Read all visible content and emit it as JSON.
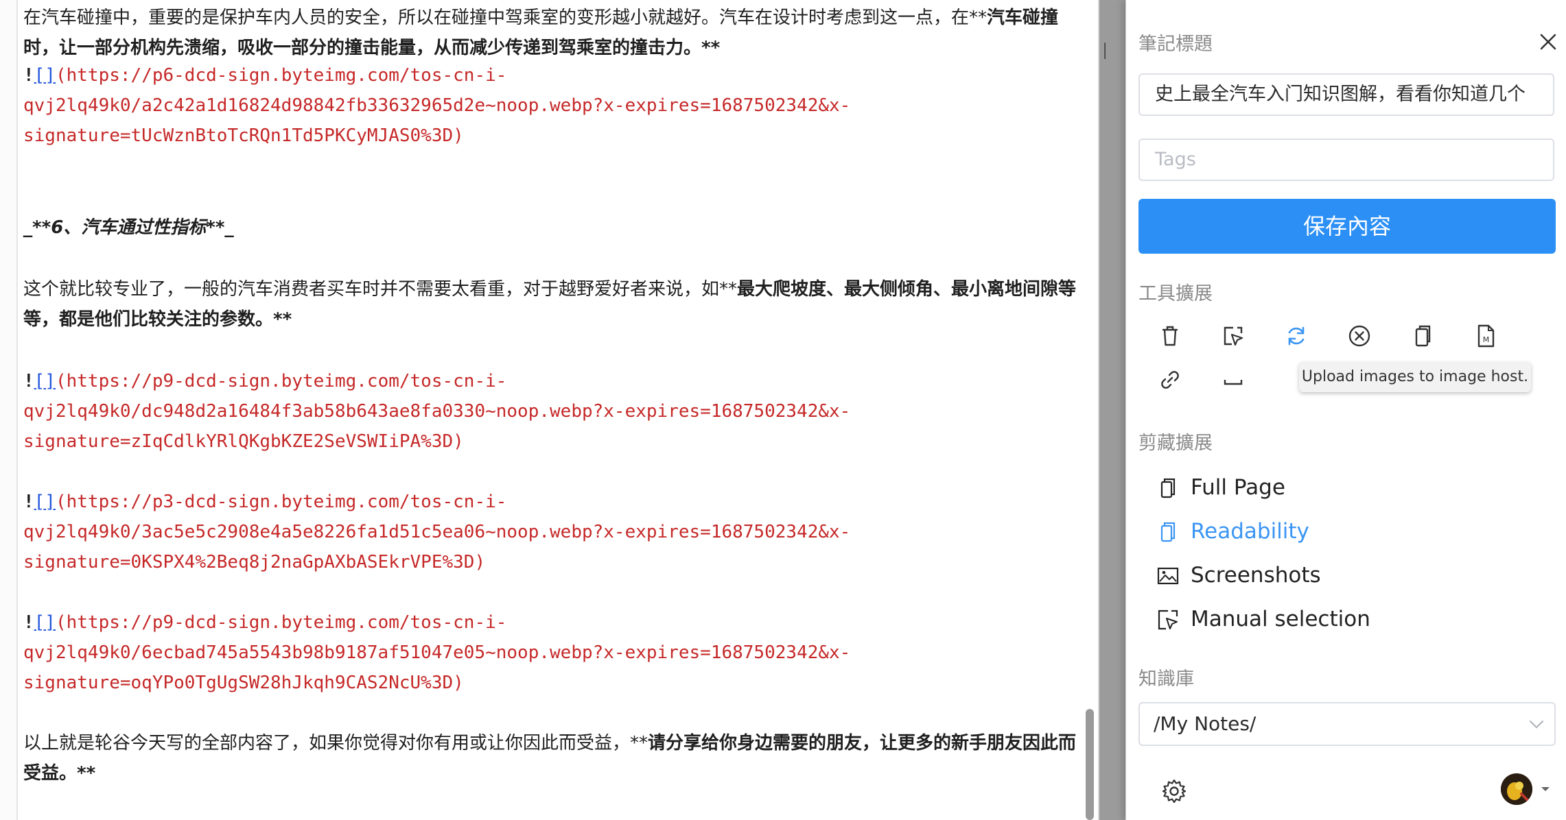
{
  "editor": {
    "para1": {
      "plain": "在汽车碰撞中，重要的是保护车内人员的安全，所以在碰撞中驾乘室的变形越小就越好。汽车在设计时考虑到这一点，在**",
      "bold": "汽车碰撞时，让一部分机构先溃缩，吸收一部分的撞击能量，从而减少传递到驾乘室的撞击力。**"
    },
    "link1": {
      "bang": "!",
      "brackets": "[]",
      "line1": "(https://p6-dcd-sign.byteimg.com/tos-cn-i-",
      "line2": "qvj2lq49k0/a2c42a1d16824d98842fb33632965d2e~noop.webp?x-expires=1687502342&x-",
      "line3": "signature=tUcWznBtoTcRQn1Td5PKCyMJAS0%3D)"
    },
    "heading": "_**6、汽车通过性指标**_",
    "para2": {
      "plain": "这个就比较专业了，一般的汽车消费者买车时并不需要太看重，对于越野爱好者来说，如**",
      "bold": "最大爬坡度、最大侧倾角、最小离地间隙等等，都是他们比较关注的参数。**"
    },
    "link2": {
      "bang": "!",
      "brackets": "[]",
      "line1": "(https://p9-dcd-sign.byteimg.com/tos-cn-i-",
      "line2": "qvj2lq49k0/dc948d2a16484f3ab58b643ae8fa0330~noop.webp?x-expires=1687502342&x-",
      "line3": "signature=zIqCdlkYRlQKgbKZE2SeVSWIiPA%3D)"
    },
    "link3": {
      "bang": "!",
      "brackets": "[]",
      "line1": "(https://p3-dcd-sign.byteimg.com/tos-cn-i-",
      "line2": "qvj2lq49k0/3ac5e5c2908e4a5e8226fa1d51c5ea06~noop.webp?x-expires=1687502342&x-",
      "line3": "signature=0KSPX4%2Beq8j2naGpAXbASEkrVPE%3D)"
    },
    "link4": {
      "bang": "!",
      "brackets": "[]",
      "line1": "(https://p9-dcd-sign.byteimg.com/tos-cn-i-",
      "line2": "qvj2lq49k0/6ecbad745a5543b98b9187af51047e05~noop.webp?x-expires=1687502342&x-",
      "line3": "signature=oqYPo0TgUgSW28hJkqh9CAS2NcU%3D)"
    },
    "para3": {
      "plain": "以上就是轮谷今天写的全部内容了，如果你觉得对你有用或让你因此而受益，**",
      "bold": "请分享给你身边需要的朋友，让更多的新手朋友因此而受益。**"
    }
  },
  "panel": {
    "note_title_label": "筆記標題",
    "note_title_value": "史上最全汽车入门知识图解，看看你知道几个",
    "tags_placeholder": "Tags",
    "save_button": "保存內容",
    "tools_label": "工具擴展",
    "tools": [
      {
        "icon": "trash-icon"
      },
      {
        "icon": "select-area-icon"
      },
      {
        "icon": "upload-refresh-icon"
      },
      {
        "icon": "clear-circle-icon"
      },
      {
        "icon": "copy-icon"
      },
      {
        "icon": "markdown-file-icon"
      },
      {
        "icon": "link-icon"
      },
      {
        "icon": "space-icon"
      }
    ],
    "tooltip": "Upload images to image host.",
    "clip_label": "剪藏擴展",
    "clip_items": [
      {
        "label": "Full Page",
        "icon": "document-icon",
        "active": false
      },
      {
        "label": "Readability",
        "icon": "document-icon",
        "active": true
      },
      {
        "label": "Screenshots",
        "icon": "image-icon",
        "active": false
      },
      {
        "label": "Manual selection",
        "icon": "select-area-icon",
        "active": false
      }
    ],
    "knowledge_label": "知識庫",
    "knowledge_value": "/My Notes/",
    "colors": {
      "accent": "#2b8ff5",
      "active_item": "#3b95f3",
      "link_red": "#c62828",
      "bracket_blue": "#2255dd"
    }
  }
}
